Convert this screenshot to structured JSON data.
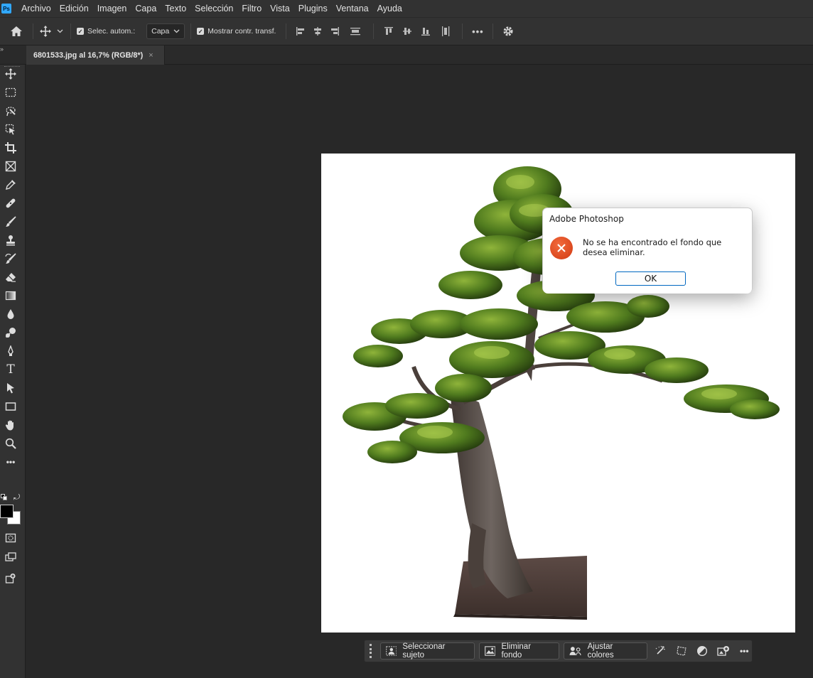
{
  "menubar": {
    "items": [
      "Archivo",
      "Edición",
      "Imagen",
      "Capa",
      "Texto",
      "Selección",
      "Filtro",
      "Vista",
      "Plugins",
      "Ventana",
      "Ayuda"
    ]
  },
  "options": {
    "auto_select_label": "Selec. autom.:",
    "layer_select_value": "Capa",
    "show_transform_label": "Mostrar contr. transf.",
    "more_label": "•••"
  },
  "document": {
    "tab_title": "6801533.jpg al 16,7% (RGB/8*)",
    "tab_close": "×"
  },
  "tools": [
    "move-tool-icon",
    "marquee-tool-icon",
    "lasso-tool-icon",
    "object-selection-tool-icon",
    "crop-tool-icon",
    "frame-tool-icon",
    "eyedropper-tool-icon",
    "healing-brush-tool-icon",
    "brush-tool-icon",
    "clone-stamp-tool-icon",
    "history-brush-tool-icon",
    "eraser-tool-icon",
    "gradient-tool-icon",
    "blur-tool-icon",
    "dodge-tool-icon",
    "pen-tool-icon",
    "type-tool-icon",
    "path-selection-tool-icon",
    "rectangle-tool-icon",
    "hand-tool-icon",
    "zoom-tool-icon"
  ],
  "toolbar_misc": {
    "more_tools": "•••",
    "type_glyph": "T"
  },
  "colors": {
    "foreground": "#000000",
    "background": "#ffffff",
    "ps_blue": "#31a8ff",
    "error_red": "#e04a1c",
    "ok_border": "#0067c0"
  },
  "dialog": {
    "title": "Adobe Photoshop",
    "message": "No se ha encontrado el fondo que desea eliminar.",
    "ok_label": "OK"
  },
  "contextual_bar": {
    "select_subject": "Seleccionar sujeto",
    "remove_background": "Eliminar fondo",
    "adjust_colors": "Ajustar colores",
    "more": "•••"
  }
}
